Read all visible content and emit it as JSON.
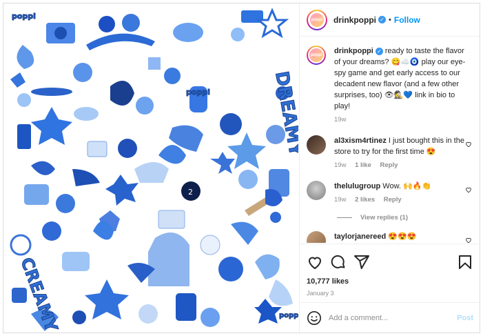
{
  "post": {
    "username": "drinkpoppi",
    "follow_label": "Follow",
    "avatar_logo_text": "poppi",
    "caption": "ready to taste the flavor of your dreams? 😋☁️🧿 play our eye-spy game and get early access to our decadent new flavor (and a few other surprises, too) 👁🕵💙 link in bio to play!",
    "caption_time": "19w",
    "likes": "10,777 likes",
    "date": "January 3"
  },
  "comments": [
    {
      "username": "al3xism4rtinez",
      "text": "I just bought this in the store to try for the first time 😍",
      "time": "19w",
      "likes": "1 like",
      "reply": "Reply"
    },
    {
      "username": "thelulugroup",
      "text": "Wow. 🙌🔥👏",
      "time": "19w",
      "likes": "2 likes",
      "reply": "Reply"
    },
    {
      "username": "taylorjanereed",
      "text": "😍😍😍"
    }
  ],
  "view_replies": "View replies (1)",
  "add_comment": {
    "placeholder": "Add a comment...",
    "post_label": "Post"
  },
  "collage_words": {
    "top_left": "poppi",
    "right": "DREAMY",
    "bottom_left": "CREAMY",
    "middle": "poppi",
    "bottom_right": "poppi"
  },
  "colors": {
    "accent": "#0095f6",
    "verified": "#3897f0",
    "collage_blue": "#2f6fd4"
  },
  "icons": [
    "heart-icon",
    "comment-icon",
    "share-icon",
    "bookmark-icon",
    "emoji-icon",
    "verified-icon"
  ]
}
